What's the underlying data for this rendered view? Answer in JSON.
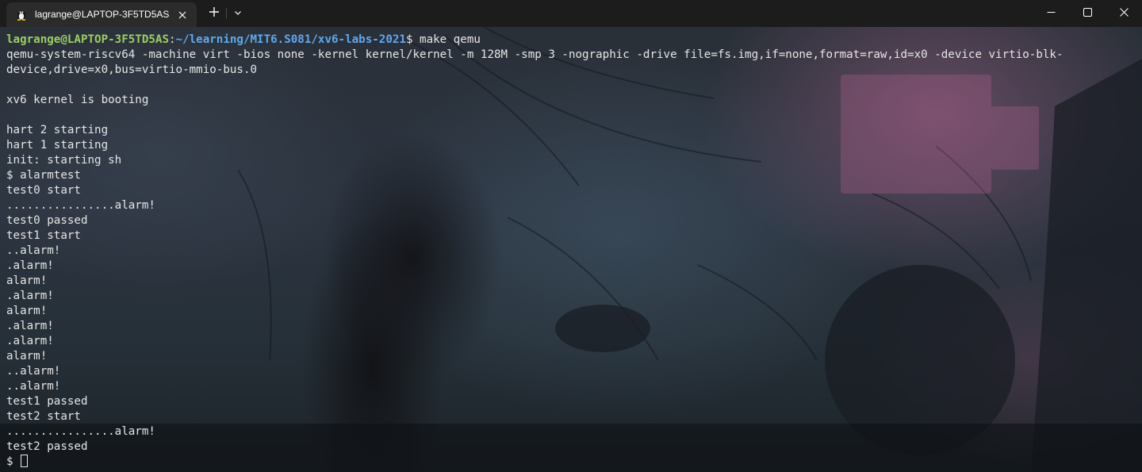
{
  "tab": {
    "title": "lagrange@LAPTOP-3F5TD5AS",
    "icon": "linux-penguin-icon"
  },
  "titlebar": {
    "new_tab_icon": "plus-icon",
    "dropdown_icon": "chevron-down-icon",
    "minimize_icon": "minimize-icon",
    "maximize_icon": "maximize-icon",
    "close_icon": "close-icon"
  },
  "terminal": {
    "prompt": {
      "user_host": "lagrange@LAPTOP-3F5TD5AS",
      "separator": ":",
      "path": "~/learning/MIT6.S081/xv6-labs-2021",
      "symbol": "$",
      "command": " make qemu"
    },
    "output": [
      "qemu-system-riscv64 -machine virt -bios none -kernel kernel/kernel -m 128M -smp 3 -nographic -drive file=fs.img,if=none,format=raw,id=x0 -device virtio-blk-",
      "device,drive=x0,bus=virtio-mmio-bus.0",
      "",
      "xv6 kernel is booting",
      "",
      "hart 2 starting",
      "hart 1 starting",
      "init: starting sh",
      "$ alarmtest",
      "test0 start",
      "................alarm!",
      "test0 passed",
      "test1 start",
      "..alarm!",
      ".alarm!",
      "alarm!",
      ".alarm!",
      "alarm!",
      ".alarm!",
      ".alarm!",
      "alarm!",
      "..alarm!",
      "..alarm!",
      "test1 passed",
      "test2 start",
      "................alarm!",
      "test2 passed"
    ],
    "final_prompt": "$ "
  },
  "colors": {
    "titlebar_bg": "#1c1c1c",
    "tab_bg": "#2b2b2b",
    "prompt_user": "#9ccc65",
    "prompt_path": "#5fa8ef",
    "text": "#e6e6e6"
  }
}
